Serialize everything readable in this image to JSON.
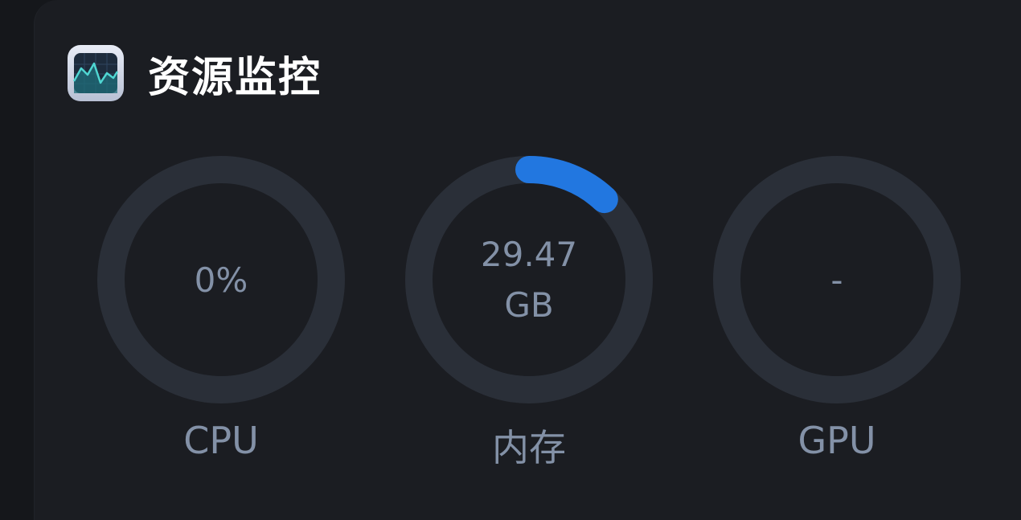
{
  "header": {
    "title": "资源监控",
    "icon": "activity-monitor-icon"
  },
  "gauges": [
    {
      "id": "cpu",
      "label": "CPU",
      "value": "0%",
      "unit": "",
      "fraction": 0
    },
    {
      "id": "mem",
      "label": "内存",
      "value": "29.47",
      "unit": "GB",
      "fraction": 0.12
    },
    {
      "id": "gpu",
      "label": "GPU",
      "value": "-",
      "unit": "",
      "fraction": 0
    }
  ],
  "colors": {
    "track": "#2a2f38",
    "progress": "#2277e0",
    "text": "#8391a7",
    "background": "#1b1d22"
  }
}
